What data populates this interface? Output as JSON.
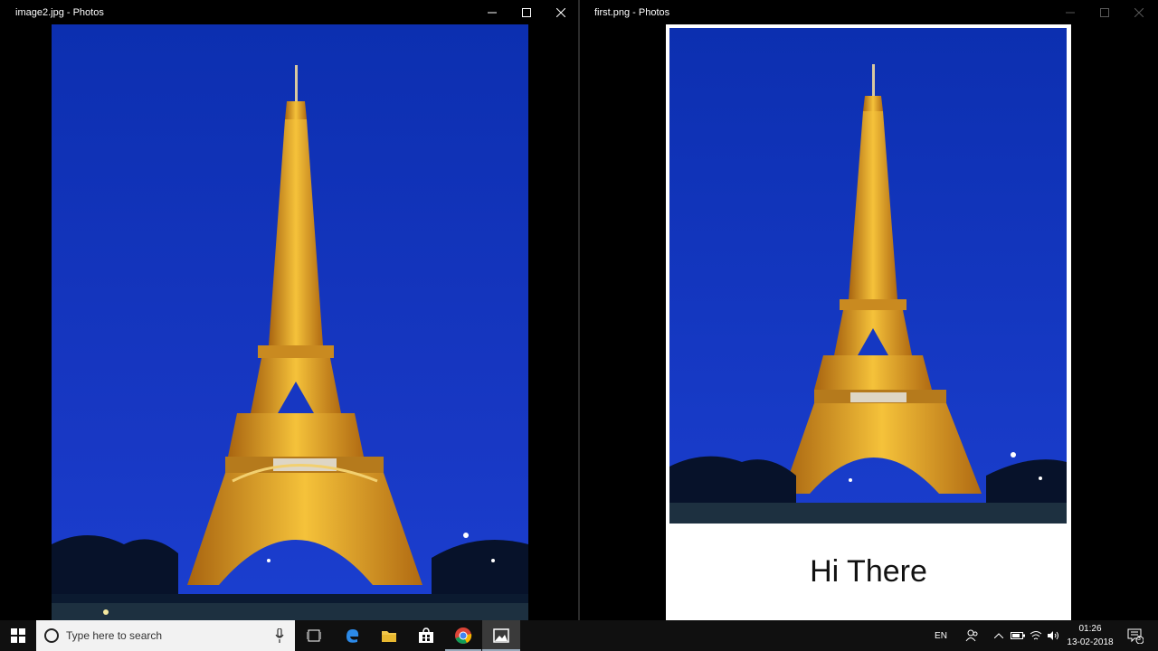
{
  "windows": [
    {
      "title": "image2.jpg - Photos"
    },
    {
      "title": "first.png - Photos"
    }
  ],
  "photo_caption": "Hi There",
  "colors": {
    "sky": "#1533b8",
    "tower": "#e8a21c",
    "taskbar": "#101010"
  },
  "taskbar": {
    "search_placeholder": "Type here to search",
    "language": "EN",
    "time": "01:26",
    "date": "13-02-2018",
    "notification_count": "3",
    "apps": [
      "task-view",
      "edge",
      "file-explorer",
      "store",
      "chrome",
      "photos"
    ]
  }
}
